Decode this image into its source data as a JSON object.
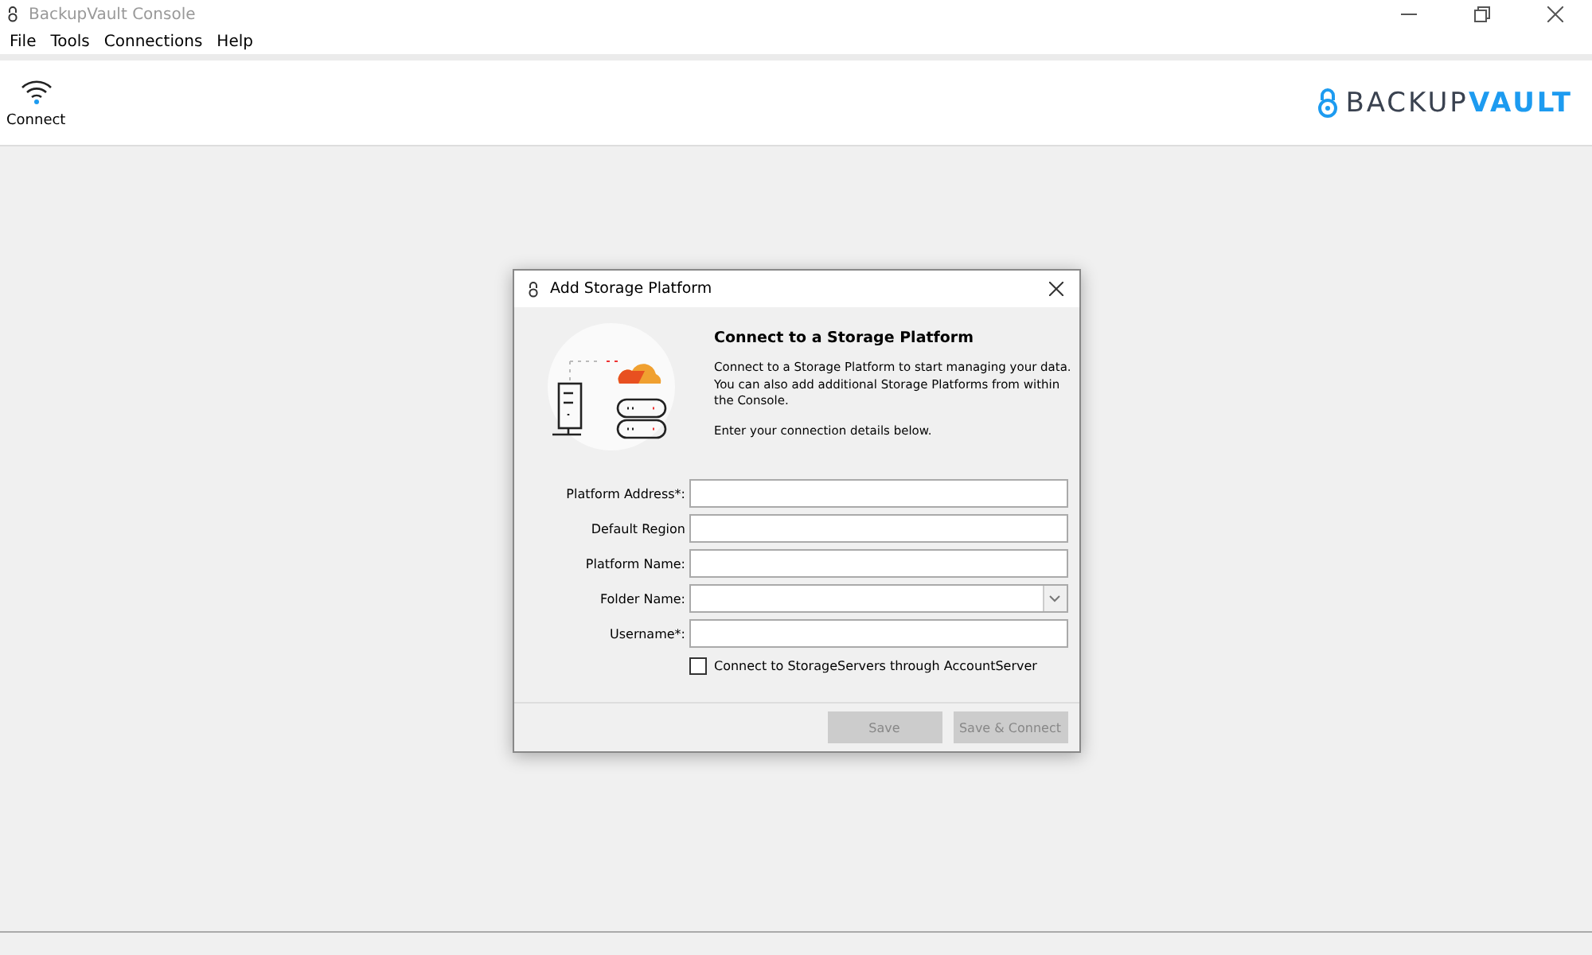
{
  "window": {
    "title": "BackupVault Console"
  },
  "menu": [
    "File",
    "Tools",
    "Connections",
    "Help"
  ],
  "toolbar": [
    {
      "label": "Connect"
    }
  ],
  "logo": {
    "first": "BACKUP",
    "second": "VAULT"
  },
  "dialog": {
    "title": "Add Storage Platform",
    "heading": "Connect to a Storage Platform",
    "description": "Connect to a Storage Platform to start managing your data. You can also add additional Storage Platforms from within the Console.",
    "instruction": "Enter your connection details below.",
    "fields": [
      {
        "label": "Platform Address*:",
        "kind": "text"
      },
      {
        "label": "Default Region",
        "kind": "text"
      },
      {
        "label": "Platform Name:",
        "kind": "text"
      },
      {
        "label": "Folder Name:",
        "kind": "dropdown"
      },
      {
        "label": "Username*:",
        "kind": "text"
      }
    ],
    "checkbox": {
      "label": "Connect to StorageServers through AccountServer",
      "checked": false
    },
    "buttons": [
      {
        "label": "Save",
        "disabled": true
      },
      {
        "label": "Save & Connect",
        "disabled": true
      }
    ]
  }
}
